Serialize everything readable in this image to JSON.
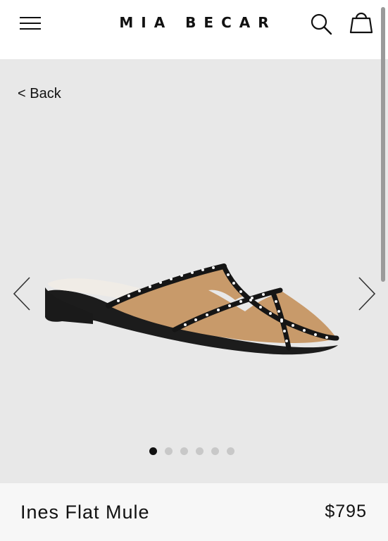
{
  "header": {
    "brand": "MIA BECAR",
    "menu_icon": "hamburger-menu-icon",
    "search_icon": "search-icon",
    "cart_icon": "shopping-bag-icon"
  },
  "gallery": {
    "back_label": "< Back",
    "prev_icon": "chevron-left-icon",
    "next_icon": "chevron-right-icon",
    "image_count": 6,
    "active_index": 0,
    "background_color": "#e8e8e8"
  },
  "product": {
    "name": "Ines Flat Mule",
    "price": "$795"
  },
  "colors": {
    "text": "#111111",
    "dot_inactive": "#c8c8c8",
    "dot_active": "#111111"
  }
}
